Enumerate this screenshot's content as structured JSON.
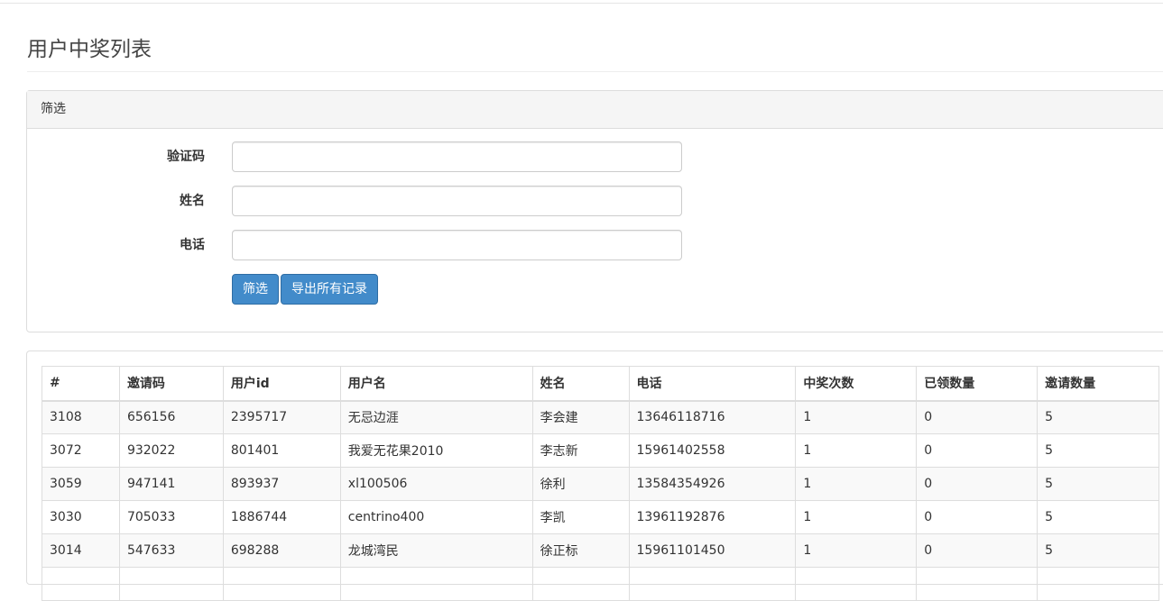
{
  "page": {
    "title": "用户中奖列表"
  },
  "filter": {
    "heading": "筛选",
    "fields": [
      {
        "label": "验证码",
        "value": "",
        "placeholder": ""
      },
      {
        "label": "姓名",
        "value": "",
        "placeholder": ""
      },
      {
        "label": "电话",
        "value": "",
        "placeholder": ""
      }
    ],
    "filter_button": "筛选",
    "export_button": "导出所有记录"
  },
  "table": {
    "headers": [
      "#",
      "邀请码",
      "用户id",
      "用户名",
      "姓名",
      "电话",
      "中奖次数",
      "已领数量",
      "邀请数量"
    ],
    "rows": [
      [
        "3108",
        "656156",
        "2395717",
        "无忌边涯",
        "李会建",
        "13646118716",
        "1",
        "0",
        "5"
      ],
      [
        "3072",
        "932022",
        "801401",
        "我爱无花果2010",
        "李志新",
        "15961402558",
        "1",
        "0",
        "5"
      ],
      [
        "3059",
        "947141",
        "893937",
        "xl100506",
        "徐利",
        "13584354926",
        "1",
        "0",
        "5"
      ],
      [
        "3030",
        "705033",
        "1886744",
        "centrino400",
        "李凯",
        "13961192876",
        "1",
        "0",
        "5"
      ],
      [
        "3014",
        "547633",
        "698288",
        "龙城湾民",
        "徐正标",
        "15961101450",
        "1",
        "0",
        "5"
      ],
      [
        "",
        "",
        "",
        "",
        "",
        "",
        "",
        "",
        ""
      ]
    ]
  },
  "colors": {
    "primary_button": "#428bca",
    "panel_heading_bg": "#f5f5f5",
    "border": "#dddddd"
  }
}
